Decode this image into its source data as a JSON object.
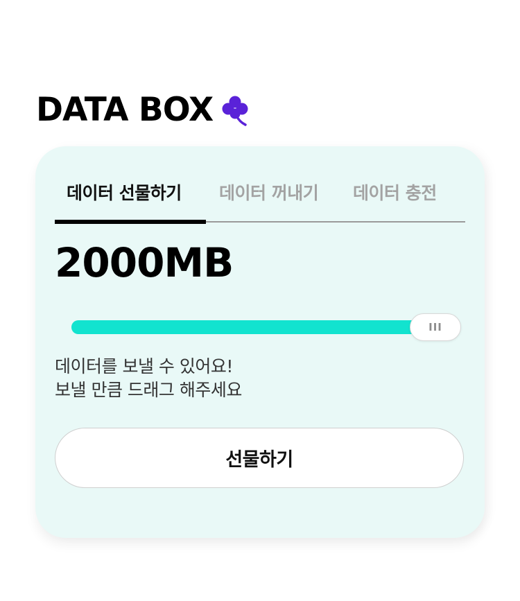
{
  "brand": {
    "title": "DATA BOX",
    "icon": "clover-icon",
    "icon_color": "#5a22d8"
  },
  "tabs": [
    {
      "label": "데이터 선물하기",
      "active": true
    },
    {
      "label": "데이터 꺼내기",
      "active": false
    },
    {
      "label": "데이터 충전",
      "active": false
    }
  ],
  "amount": "2000MB",
  "slider": {
    "value_fraction": 1.0,
    "fill_color": "#12e3cf",
    "handle_icon": "grip-icon"
  },
  "hint": {
    "line1": "데이터를 보낼 수 있어요!",
    "line2": "보낼 만큼 드래그 해주세요"
  },
  "gift_button": {
    "label": "선물하기"
  },
  "colors": {
    "card_background": "#e9f9f7",
    "accent": "#12e3cf"
  }
}
